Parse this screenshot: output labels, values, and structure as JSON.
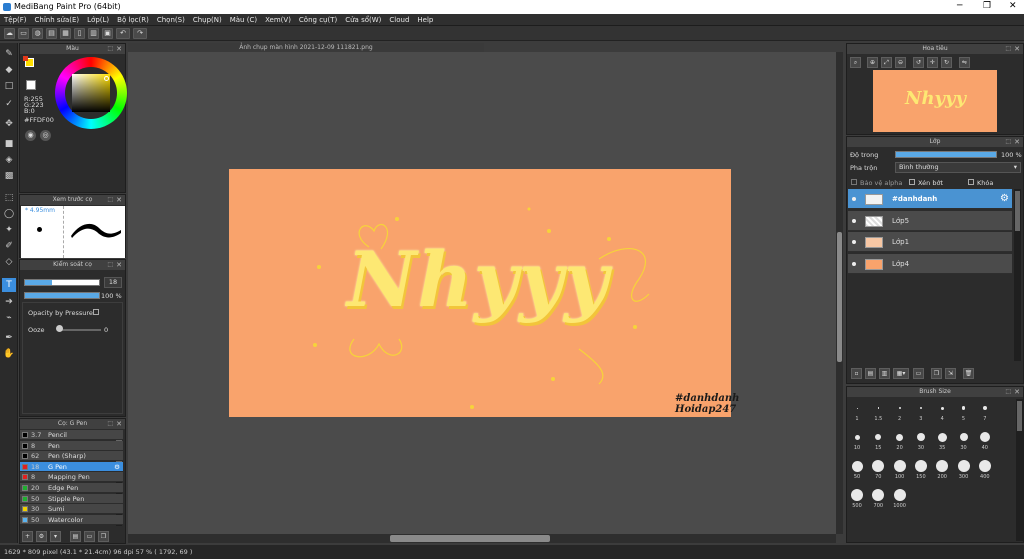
{
  "window": {
    "title": "MediBang Paint Pro (64bit)"
  },
  "menu": [
    "Tệp(F)",
    "Chỉnh sửa(E)",
    "Lớp(L)",
    "Bộ lọc(R)",
    "Chọn(S)",
    "Chụp(N)",
    "Màu (C)",
    "Xem(V)",
    "Công cụ(T)",
    "Cửa sổ(W)",
    "Cloud",
    "Help"
  ],
  "document": {
    "tab": "Ảnh chụp màn hình 2021-12-09 111821.png",
    "artwork_text": "Nhyyy",
    "watermark_1": "#danhdanh",
    "watermark_2": "Hoidap247"
  },
  "color_panel": {
    "title": "Màu",
    "r": "R:255",
    "g": "G:223",
    "b": "B:0",
    "hex": "#FFDF00"
  },
  "preview_panel": {
    "title": "Xem trước cọ",
    "size": "4.95mm"
  },
  "brush_control": {
    "title": "Kiểm soát cọ",
    "size_value": "18",
    "opacity_value": "100 %",
    "opacity_by_pressure": "Opacity by Pressure",
    "ooze_label": "Ooze",
    "ooze_value": "0"
  },
  "brush_list": {
    "title": "Cọ: G Pen",
    "items": [
      {
        "size": "3.7",
        "name": "Pencil",
        "color": "#000000"
      },
      {
        "size": "8",
        "name": "Pen",
        "color": "#000000"
      },
      {
        "size": "62",
        "name": "Pen (Sharp)",
        "color": "#000000"
      },
      {
        "size": "18",
        "name": "G Pen",
        "color": "#e02020"
      },
      {
        "size": "8",
        "name": "Mapping Pen",
        "color": "#e02020"
      },
      {
        "size": "20",
        "name": "Edge Pen",
        "color": "#1fae2f"
      },
      {
        "size": "50",
        "name": "Stipple Pen",
        "color": "#1fae2f"
      },
      {
        "size": "30",
        "name": "Sumi",
        "color": "#f0d000"
      },
      {
        "size": "50",
        "name": "Watercolor",
        "color": "#5ab4f0"
      }
    ]
  },
  "navigator": {
    "title": "Hoa tiêu"
  },
  "layer_panel": {
    "title": "Lớp",
    "opacity_label": "Độ trong",
    "opacity_value": "100 %",
    "blend_label": "Pha trộn",
    "blend_value": "Bình thường",
    "protect_alpha": "Bảo vệ alpha",
    "clipping": "Xén bớt",
    "lock": "Khóa",
    "layers": [
      {
        "name": "#danhdanh",
        "selected": true
      },
      {
        "name": "Lớp5",
        "selected": false
      },
      {
        "name": "Lớp1",
        "selected": false
      },
      {
        "name": "Lớp4",
        "selected": false
      }
    ]
  },
  "brush_size_panel": {
    "title": "Brush Size",
    "sizes": [
      "1",
      "1.5",
      "2",
      "3",
      "4",
      "5",
      "7",
      "10",
      "15",
      "20",
      "30",
      "35",
      "30",
      "40",
      "50",
      "70",
      "100",
      "150",
      "200",
      "300",
      "400",
      "500",
      "700",
      "1000"
    ]
  },
  "status": {
    "text": "1629 * 809 pixel   (43.1 * 21.4cm)   96 dpi   57 %   ( 1792, 69 )"
  },
  "colors": {
    "accent": "#3b8ede",
    "canvas_bg": "#f9a36c",
    "primary_color": "#FFDF00"
  }
}
